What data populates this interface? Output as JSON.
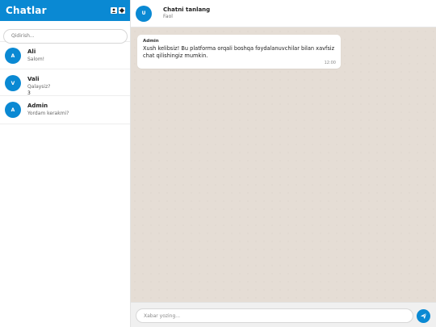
{
  "sidebar": {
    "title": "Chatlar",
    "icons": [
      "user-icon",
      "settings-icon"
    ],
    "search": {
      "placeholder": "Qidirish..."
    },
    "chats": [
      {
        "avatar": "A",
        "name": "Ali",
        "preview": "Salom!",
        "unread": ""
      },
      {
        "avatar": "V",
        "name": "Vali",
        "preview": "Qalaysiz?",
        "unread": "3"
      },
      {
        "avatar": "A",
        "name": "Admin",
        "preview": "Yordam kerakmi?",
        "unread": ""
      }
    ]
  },
  "header": {
    "avatar": "U",
    "title": "Chatni tanlang",
    "status": "Faol"
  },
  "messages": [
    {
      "sender": "Admin",
      "text": "Xush kelibsiz! Bu platforma orqali boshqa foydalanuvchilar bilan xavfsiz chat qilishingiz mumkin.",
      "time": "12:00"
    }
  ],
  "composer": {
    "placeholder": "Xabar yozing...",
    "send_icon": "send-icon"
  },
  "colors": {
    "accent": "#0a89d3",
    "chat_background": "#e5ddd5",
    "bubble": "#ffffff"
  }
}
